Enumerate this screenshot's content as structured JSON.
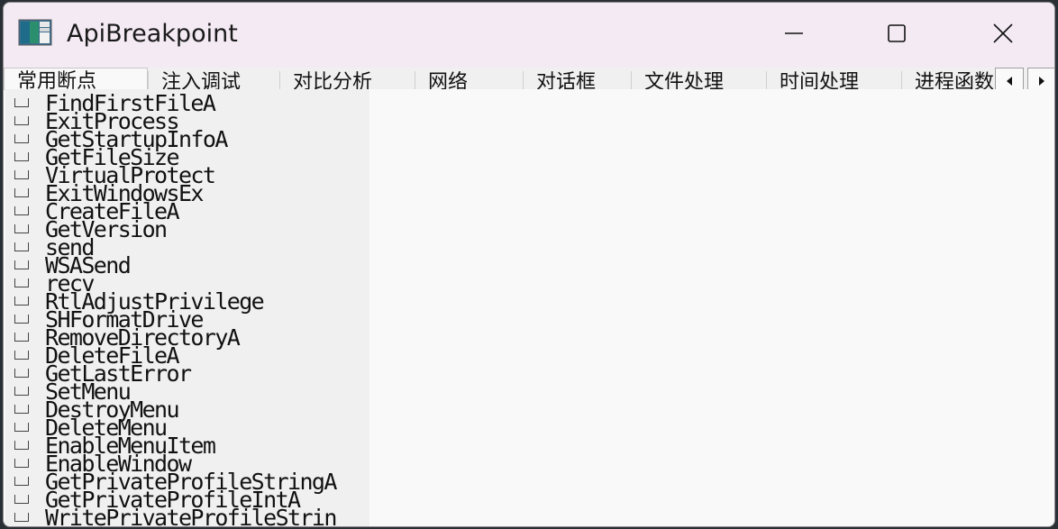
{
  "window": {
    "title": "ApiBreakpoint"
  },
  "icons": {
    "app": "application-window-icon",
    "minimize": "minimize-icon",
    "maximize": "maximize-icon",
    "close": "close-icon",
    "scroll_left": "chevron-left-icon",
    "scroll_right": "chevron-right-icon"
  },
  "tabs": [
    {
      "label": "常用断点",
      "active": true
    },
    {
      "label": "注入调试",
      "active": false
    },
    {
      "label": "对比分析",
      "active": false
    },
    {
      "label": "网络",
      "active": false
    },
    {
      "label": "对话框",
      "active": false
    },
    {
      "label": "文件处理",
      "active": false
    },
    {
      "label": "时间处理",
      "active": false
    },
    {
      "label": "进程函数",
      "active": false
    }
  ],
  "breakpoints": [
    {
      "label": "FindFirstFileA",
      "checked": false
    },
    {
      "label": "ExitProcess",
      "checked": false
    },
    {
      "label": "GetStartupInfoA",
      "checked": false
    },
    {
      "label": "GetFileSize",
      "checked": false
    },
    {
      "label": "VirtualProtect",
      "checked": false
    },
    {
      "label": "ExitWindowsEx",
      "checked": false
    },
    {
      "label": "CreateFileA",
      "checked": false
    },
    {
      "label": "GetVersion",
      "checked": false
    },
    {
      "label": "send",
      "checked": false
    },
    {
      "label": "WSASend",
      "checked": false
    },
    {
      "label": "recv",
      "checked": false
    },
    {
      "label": "RtlAdjustPrivilege",
      "checked": false
    },
    {
      "label": "SHFormatDrive",
      "checked": false
    },
    {
      "label": "RemoveDirectoryA",
      "checked": false
    },
    {
      "label": "DeleteFileA",
      "checked": false
    },
    {
      "label": "GetLastError",
      "checked": false
    },
    {
      "label": "SetMenu",
      "checked": false
    },
    {
      "label": "DestroyMenu",
      "checked": false
    },
    {
      "label": "DeleteMenu",
      "checked": false
    },
    {
      "label": "EnableMenuItem",
      "checked": false
    },
    {
      "label": "EnableWindow",
      "checked": false
    },
    {
      "label": "GetPrivateProfileStringA",
      "checked": false
    },
    {
      "label": "GetPrivateProfileIntA",
      "checked": false
    },
    {
      "label": "WritePrivateProfileStrin",
      "checked": false
    }
  ]
}
